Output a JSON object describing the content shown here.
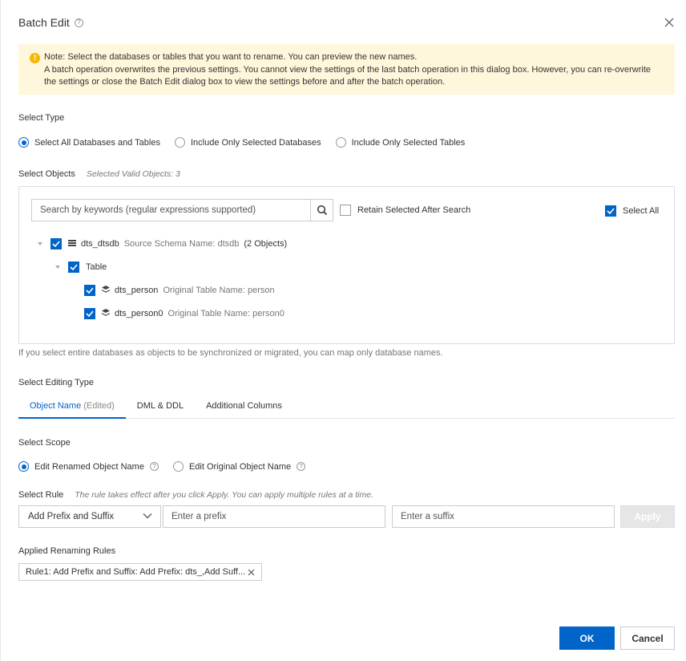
{
  "dialog": {
    "title": "Batch Edit"
  },
  "notice": {
    "line1": "Note: Select the databases or tables that you want to rename. You can preview the new names.",
    "line2": "A batch operation overwrites the previous settings. You cannot view the settings of the last batch operation in this dialog box. However, you can re-overwrite the settings or close the Batch Edit dialog box to view the settings before and after the batch operation."
  },
  "select_type": {
    "label": "Select Type",
    "options": [
      "Select All Databases and Tables",
      "Include Only Selected Databases",
      "Include Only Selected Tables"
    ],
    "selected_index": 0
  },
  "select_objects": {
    "label": "Select Objects",
    "hint": "Selected Valid Objects: 3",
    "search_placeholder": "Search by keywords (regular expressions supported)",
    "retain_label": "Retain Selected After Search",
    "retain_checked": false,
    "select_all_label": "Select All",
    "select_all_checked": true,
    "tree": {
      "db_name": "dts_dtsdb",
      "db_meta": "Source Schema Name: dtsdb",
      "db_count": "(2 Objects)",
      "group_label": "Table",
      "tables": [
        {
          "name": "dts_person",
          "meta": "Original Table Name: person"
        },
        {
          "name": "dts_person0",
          "meta": "Original Table Name: person0"
        }
      ]
    },
    "footnote": "If you select entire databases as objects to be synchronized or migrated, you can map only database names."
  },
  "editing_type": {
    "label": "Select Editing Type",
    "tabs": [
      {
        "label": "Object Name",
        "suffix": "(Edited)"
      },
      {
        "label": "DML & DDL",
        "suffix": ""
      },
      {
        "label": "Additional Columns",
        "suffix": ""
      }
    ],
    "active_index": 0
  },
  "scope": {
    "label": "Select Scope",
    "options": [
      "Edit Renamed Object Name",
      "Edit Original Object Name"
    ],
    "selected_index": 0
  },
  "rule": {
    "label": "Select Rule",
    "hint": "The rule takes effect after you click Apply. You can apply multiple rules at a time.",
    "selected": "Add Prefix and Suffix",
    "prefix_placeholder": "Enter a prefix",
    "suffix_placeholder": "Enter a suffix",
    "apply_label": "Apply"
  },
  "applied": {
    "label": "Applied Renaming Rules",
    "tags": [
      "Rule1: Add Prefix and Suffix:  Add Prefix: dts_,Add Suff..."
    ]
  },
  "footer": {
    "ok_label": "OK",
    "cancel_label": "Cancel"
  },
  "colors": {
    "primary": "#0064c8",
    "notice_bg": "#fff7db",
    "warn": "#f5b700"
  }
}
